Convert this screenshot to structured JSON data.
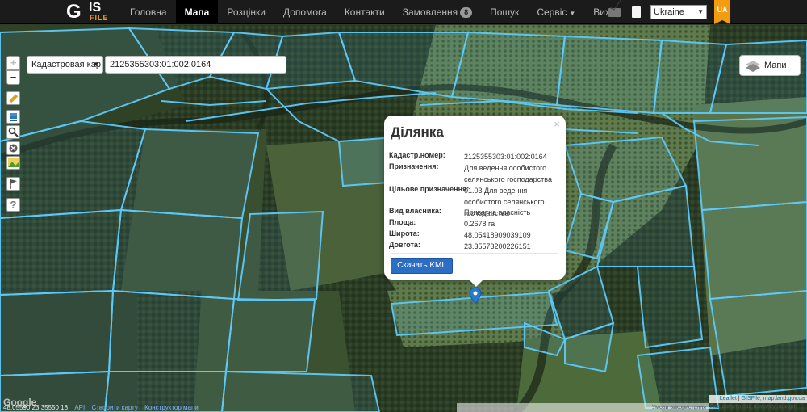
{
  "brand": {
    "logo_main": "G",
    "logo_sub": "IS",
    "logo_tag": "FILE"
  },
  "nav": {
    "items": [
      {
        "label": "Головна"
      },
      {
        "label": "Мапа",
        "active": true
      },
      {
        "label": "Розцінки"
      },
      {
        "label": "Допомога"
      },
      {
        "label": "Контакти"
      },
      {
        "label": "Замовлення"
      },
      {
        "label": "Пошук"
      },
      {
        "label": "Сервіс"
      },
      {
        "label": "Вихід"
      }
    ],
    "orders_badge": "8"
  },
  "header": {
    "icons": [
      "mail-icon",
      "document-icon"
    ],
    "country": "Ukraine",
    "lang": "UA"
  },
  "map_controls": {
    "zoom_in": "+",
    "zoom_out": "−",
    "layer_select": "Кадастровая кар",
    "search_value": "2125355303:01:002:0164",
    "maps_button": "Мапи",
    "tools": [
      "ruler-icon",
      "layers-stack-icon",
      "magnifier-icon",
      "clear-icon",
      "landscape-icon",
      "flag-icon",
      "help-icon"
    ]
  },
  "popup": {
    "title": "Ділянка",
    "close": "×",
    "rows": [
      {
        "key": "Кадастр.номер:",
        "value": "2125355303:01:002:0164"
      },
      {
        "key": "Призначення:",
        "value": "Для ведення особистого селянського господарства"
      },
      {
        "key": "Цільове призначення:",
        "value": "01.03 Для ведення особистого селянського господарства"
      },
      {
        "key": "Вид власника:",
        "value": "Приватна власність"
      },
      {
        "key": "Площа:",
        "value": "0.2678 га"
      },
      {
        "key": "Широта:",
        "value": "48.05418909039109"
      },
      {
        "key": "Довгота:",
        "value": "23.35573200226151"
      }
    ],
    "kml_button": "Скачать KML"
  },
  "footer": {
    "google": "Google",
    "coords": "48.05590 23.35550 18",
    "links": [
      "API",
      "Створити карту",
      "Конструктор мапи"
    ],
    "terms": "Умови використання",
    "report": "Повідомити про помилку на карті",
    "leaflet": "Leaflet",
    "gisfile_attr": "GISFile, map.land.gov.ua"
  },
  "colors": {
    "accent": "#f39c12",
    "parcel_stroke": "#5ec8f8",
    "button": "#2c6ec4"
  }
}
